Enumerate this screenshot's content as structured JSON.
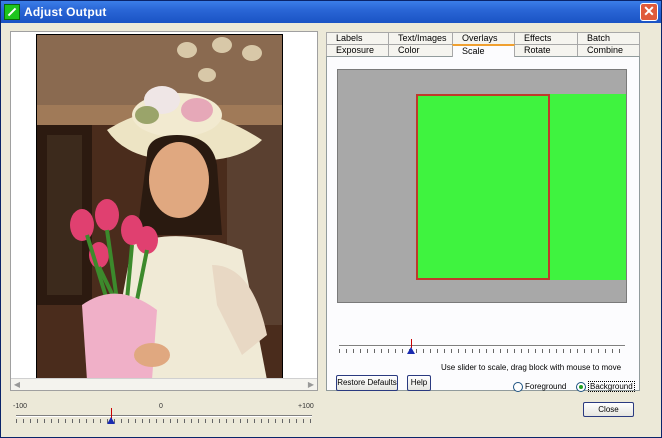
{
  "window": {
    "title": "Adjust Output"
  },
  "tabs_row1": [
    "Labels",
    "Text/Images",
    "Overlays",
    "Effects",
    "Batch"
  ],
  "tabs_row2": [
    "Exposure",
    "Color",
    "Scale",
    "Rotate",
    "Combine"
  ],
  "active_tab": "Scale",
  "scale_panel": {
    "hint": "Use slider to scale,  drag block with mouse to move",
    "restore_label": "Restore Defaults",
    "help_label": "Help",
    "radio_foreground": "Foreground",
    "radio_background": "Background",
    "selected_radio": "Background",
    "scale_slider_fraction": 0.25
  },
  "main_slider": {
    "min_label": "-100",
    "mid_label": "0",
    "max_label": "+100",
    "value_fraction": 0.32
  },
  "buttons": {
    "close_label": "Close"
  },
  "colors": {
    "block_fill": "#3ff33f",
    "block_border": "#c0392b",
    "title_bar": "#2a66d6"
  }
}
